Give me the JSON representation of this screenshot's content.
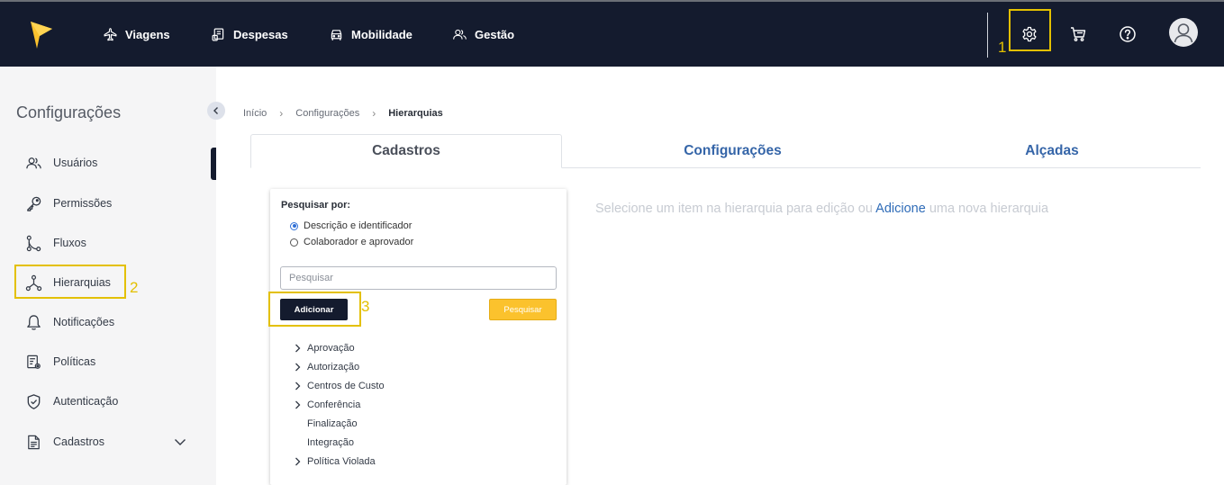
{
  "topbar": {
    "nav": [
      {
        "label": "Viagens",
        "icon": "airplane-icon"
      },
      {
        "label": "Despesas",
        "icon": "receipt-icon"
      },
      {
        "label": "Mobilidade",
        "icon": "car-icon"
      },
      {
        "label": "Gestão",
        "icon": "users-icon"
      }
    ],
    "icons": [
      "gear-icon",
      "cart-icon",
      "help-icon",
      "avatar-icon"
    ],
    "accent": "#141b2e",
    "logo_color": "#fbc22d"
  },
  "annotations": {
    "n1": "1",
    "n2": "2",
    "n3": "3",
    "color": "#e3c000"
  },
  "sidebar": {
    "title": "Configurações",
    "items": [
      {
        "label": "Usuários",
        "icon": "users-icon"
      },
      {
        "label": "Permissões",
        "icon": "key-icon"
      },
      {
        "label": "Fluxos",
        "icon": "flow-icon"
      },
      {
        "label": "Hierarquias",
        "icon": "hierarchy-icon"
      },
      {
        "label": "Notificações",
        "icon": "bell-icon"
      },
      {
        "label": "Políticas",
        "icon": "policy-icon"
      },
      {
        "label": "Autenticação",
        "icon": "shield-icon"
      },
      {
        "label": "Cadastros",
        "icon": "document-icon"
      }
    ]
  },
  "breadcrumb": {
    "items": [
      "Início",
      "Configurações",
      "Hierarquias"
    ]
  },
  "tabs": [
    "Cadastros",
    "Configurações",
    "Alçadas"
  ],
  "panel": {
    "search_by": "Pesquisar por:",
    "options": [
      "Descrição e identificador",
      "Colaborador e aprovador"
    ],
    "search_placeholder": "Pesquisar",
    "add_label": "Adicionar",
    "search_label": "Pesquisar",
    "tree": [
      {
        "label": "Aprovação",
        "expandable": true
      },
      {
        "label": "Autorização",
        "expandable": true
      },
      {
        "label": "Centros de Custo",
        "expandable": true
      },
      {
        "label": "Conferência",
        "expandable": true
      },
      {
        "label": "Finalização",
        "expandable": false
      },
      {
        "label": "Integração",
        "expandable": false
      },
      {
        "label": "Política Violada",
        "expandable": true
      }
    ]
  },
  "hint": {
    "before": "Selecione um item na hierarquia para edição ou",
    "link": "Adicione",
    "after": "uma nova hierarquia"
  }
}
